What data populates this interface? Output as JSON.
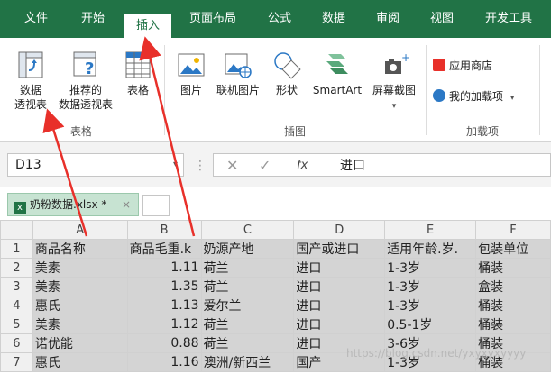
{
  "ribbon_tabs": [
    "文件",
    "开始",
    "插入",
    "页面布局",
    "公式",
    "数据",
    "审阅",
    "视图",
    "开发工具"
  ],
  "ribbon": {
    "pivot_table": [
      "数据",
      "透视表"
    ],
    "recommended_pivot": [
      "推荐的",
      "数据透视表"
    ],
    "table": "表格",
    "group_tables": "表格",
    "picture": "图片",
    "online_picture": "联机图片",
    "shapes": "形状",
    "smartart": "SmartArt",
    "screenshot": "屏幕截图",
    "group_illustrations": "插图",
    "app_store": "应用商店",
    "my_addins": "我的加载项",
    "group_addins": "加载项"
  },
  "formula_bar": {
    "name_box": "D13",
    "fx": "fx",
    "value": "进口"
  },
  "workbook_tab": {
    "name": "奶粉数据.xlsx *",
    "close": "×"
  },
  "grid": {
    "columns": [
      "A",
      "B",
      "C",
      "D",
      "E",
      "F"
    ],
    "rows": [
      {
        "n": "1",
        "cells": [
          "商品名称",
          "商品毛重.k",
          "奶源产地",
          "国产或进口",
          "适用年龄.岁.",
          "包装单位"
        ]
      },
      {
        "n": "2",
        "cells": [
          "美素",
          "1.11",
          "荷兰",
          "进口",
          "1-3岁",
          "桶装"
        ]
      },
      {
        "n": "3",
        "cells": [
          "美素",
          "1.35",
          "荷兰",
          "进口",
          "1-3岁",
          "盒装"
        ]
      },
      {
        "n": "4",
        "cells": [
          "惠氏",
          "1.13",
          "爱尔兰",
          "进口",
          "1-3岁",
          "桶装"
        ]
      },
      {
        "n": "5",
        "cells": [
          "美素",
          "1.12",
          "荷兰",
          "进口",
          "0.5-1岁",
          "桶装"
        ]
      },
      {
        "n": "6",
        "cells": [
          "诺优能",
          "0.88",
          "荷兰",
          "进口",
          "3-6岁",
          "桶装"
        ]
      },
      {
        "n": "7",
        "cells": [
          "惠氏",
          "1.16",
          "澳洲/新西兰",
          "国产",
          "1-3岁",
          "桶装"
        ]
      }
    ]
  },
  "watermark": "https://blog.csdn.net/yxyxyxyyyy",
  "colors": {
    "excel_green": "#217346",
    "arrow_red": "#e8302a"
  }
}
